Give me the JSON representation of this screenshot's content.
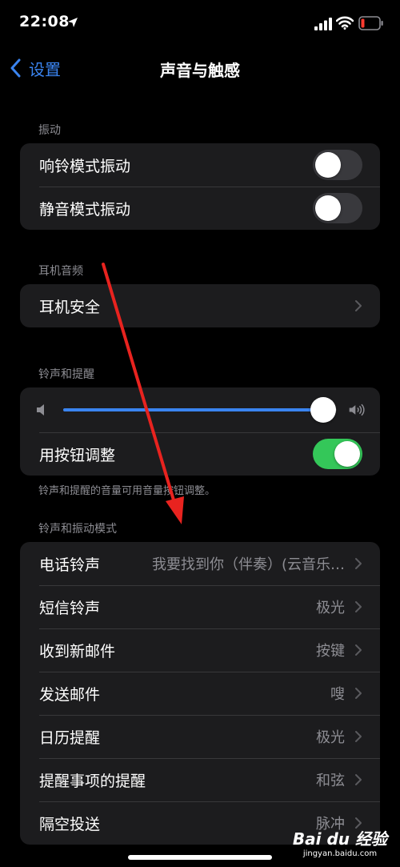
{
  "status_bar": {
    "time": "22:08"
  },
  "nav": {
    "back_label": "设置",
    "title": "声音与触感"
  },
  "vibration": {
    "header": "振动",
    "rows": [
      {
        "label": "响铃模式振动",
        "on": false
      },
      {
        "label": "静音模式振动",
        "on": false
      }
    ]
  },
  "headphone": {
    "header": "耳机音频",
    "rows": [
      {
        "label": "耳机安全"
      }
    ]
  },
  "ringer": {
    "header": "铃声和提醒",
    "volume_level": 0.95,
    "button_adjust_label": "用按钮调整",
    "button_adjust_on": true,
    "footer": "铃声和提醒的音量可用音量按钮调整。"
  },
  "patterns": {
    "header": "铃声和振动模式",
    "rows": [
      {
        "label": "电话铃声",
        "value": "我要找到你（伴奏）(云音乐…"
      },
      {
        "label": "短信铃声",
        "value": "极光"
      },
      {
        "label": "收到新邮件",
        "value": "按键"
      },
      {
        "label": "发送邮件",
        "value": "嗖"
      },
      {
        "label": "日历提醒",
        "value": "极光"
      },
      {
        "label": "提醒事项的提醒",
        "value": "和弦"
      },
      {
        "label": "隔空投送",
        "value": "脉冲"
      }
    ]
  },
  "watermark": {
    "logo": "Bai du 经验",
    "url": "jingyan.baidu.com"
  },
  "colors": {
    "accent": "#3a84f0",
    "toggle_on": "#34c759",
    "annotation_arrow": "#e8231f"
  }
}
